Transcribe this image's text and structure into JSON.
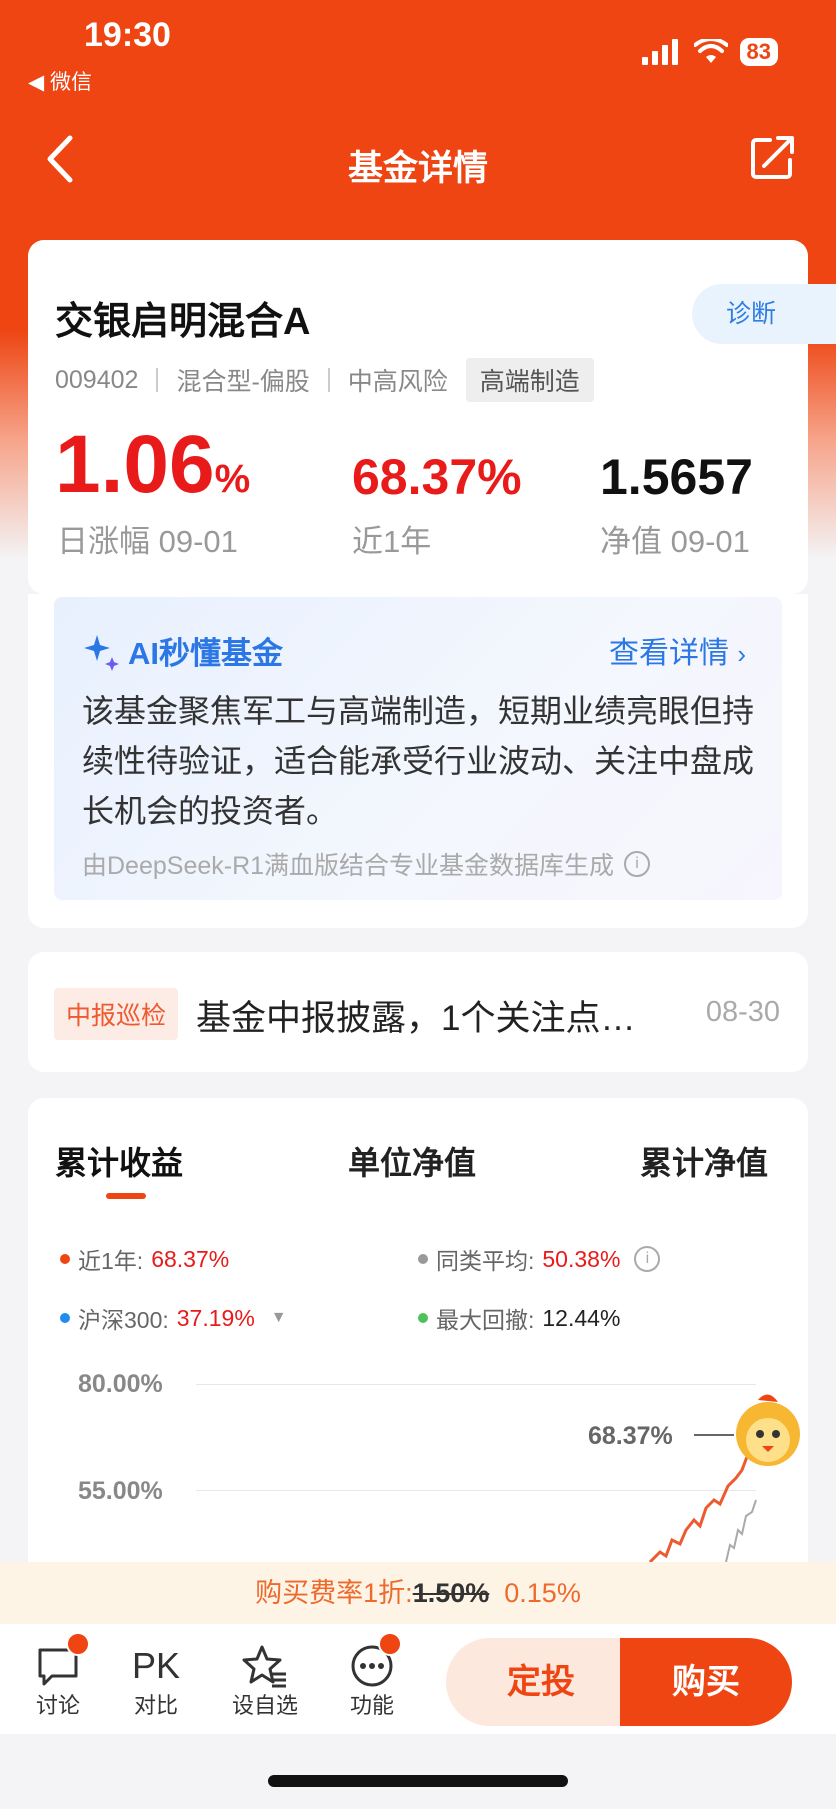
{
  "status_bar": {
    "time": "19:30",
    "back_app": "◀ 微信",
    "battery": "83"
  },
  "nav": {
    "title": "基金详情"
  },
  "fund": {
    "name": "交银启明混合A",
    "diagnose": "诊断",
    "code": "009402",
    "type": "混合型-偏股",
    "risk": "中高风险",
    "tag": "高端制造",
    "daily_change": "1.06",
    "daily_change_unit": "%",
    "daily_label": "日涨幅 09-01",
    "year_return": "68.37%",
    "year_label": "近1年",
    "nav_value": "1.5657",
    "nav_label": "净值 09-01"
  },
  "ai": {
    "title": "AI秒懂基金",
    "more": "查看详情",
    "text": "该基金聚焦军工与高端制造，短期业绩亮眼但持续性待验证，适合能承受行业波动、关注中盘成长机会的投资者。",
    "footer": "由DeepSeek-R1满血版结合专业基金数据库生成"
  },
  "notice": {
    "badge": "中报巡检",
    "text": "基金中报披露，1个关注点…",
    "date": "08-30"
  },
  "tabs": [
    "累计收益",
    "单位净值",
    "累计净值"
  ],
  "legend": {
    "year_label": "近1年:",
    "year_value": "68.37%",
    "avg_label": "同类平均:",
    "avg_value": "50.38%",
    "hs_label": "沪深300:",
    "hs_value": "37.19%",
    "dd_label": "最大回撤:",
    "dd_value": "12.44%"
  },
  "colors": {
    "brand": "#ee4513",
    "up_red": "#e81a1a",
    "ai_blue": "#2b77e6",
    "hs300": "#1f8cf0",
    "drawdown": "#4cc35a",
    "avg": "#999999"
  },
  "chart_data": {
    "type": "line",
    "yticks": [
      "80.00%",
      "55.00%"
    ],
    "end_label": "68.37%",
    "series": [
      {
        "name": "近1年",
        "end_value": 68.37
      },
      {
        "name": "同类平均",
        "end_value": 50.38
      }
    ]
  },
  "fee": {
    "prefix": "购买费率1折:",
    "original": "1.50%",
    "discount": "0.15%"
  },
  "bottom_nav": {
    "discuss": "讨论",
    "pk_icon": "PK",
    "compare": "对比",
    "watch": "设自选",
    "func": "功能",
    "invest": "定投",
    "buy": "购买"
  }
}
